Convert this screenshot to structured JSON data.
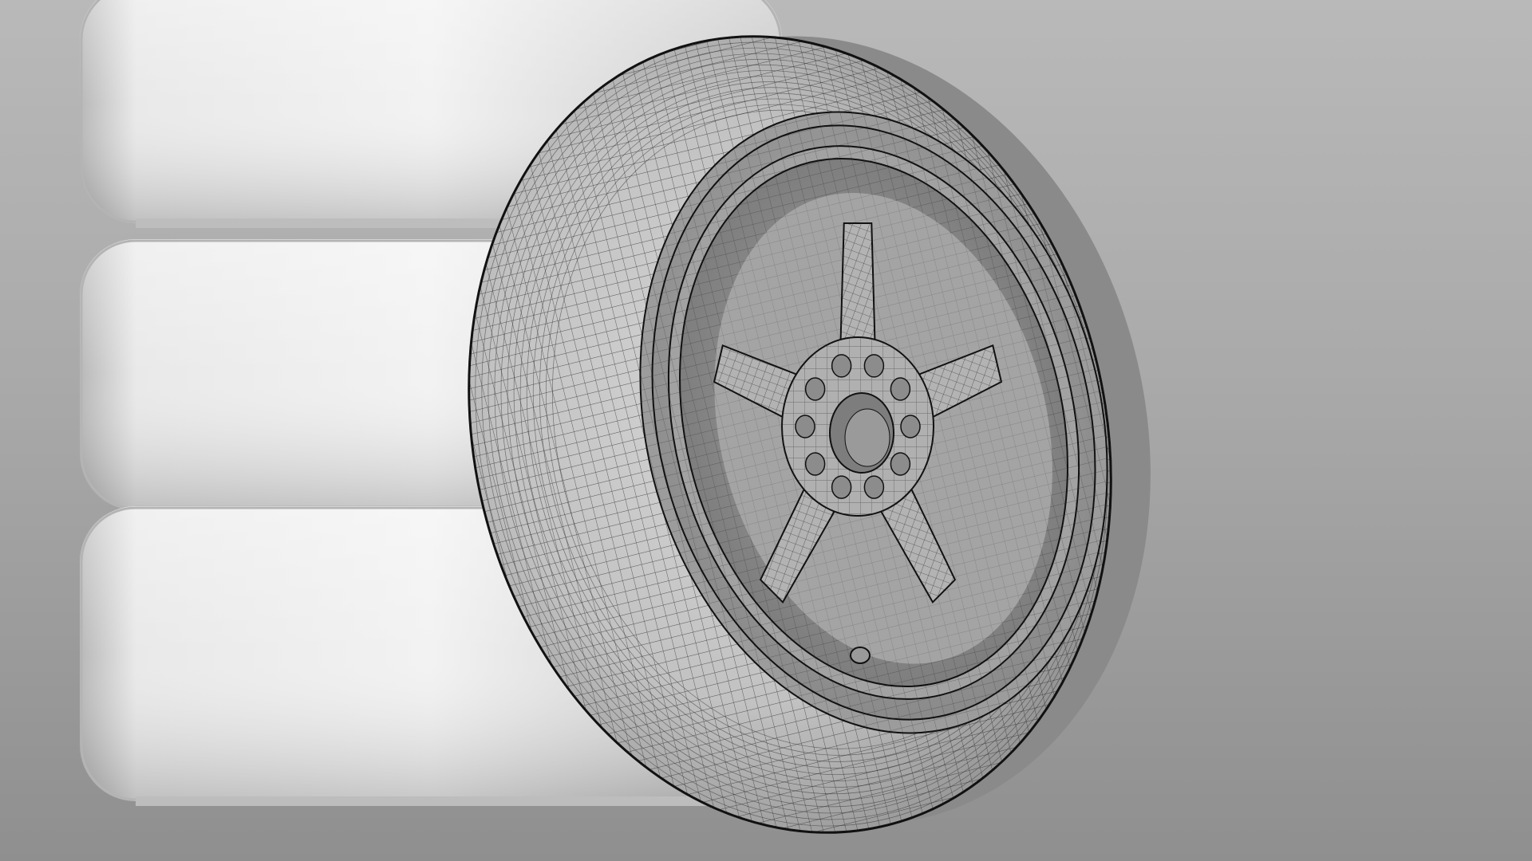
{
  "scene": {
    "background": {
      "top": "#b9b9b9",
      "middle": "#a9a9a9",
      "bottom": "#8f8f8f"
    },
    "render_style": "clay-wireframe",
    "colors": {
      "clay_light": "#f0f0f0",
      "clay_mid": "#d6d6d6",
      "clay_shadow": "#b4b4b4",
      "wire": "#2a2a2a",
      "edge": "#111111"
    },
    "objects": {
      "tire_stack_count": 3,
      "spoke_count": 5,
      "lug_hole_count": 10
    }
  }
}
